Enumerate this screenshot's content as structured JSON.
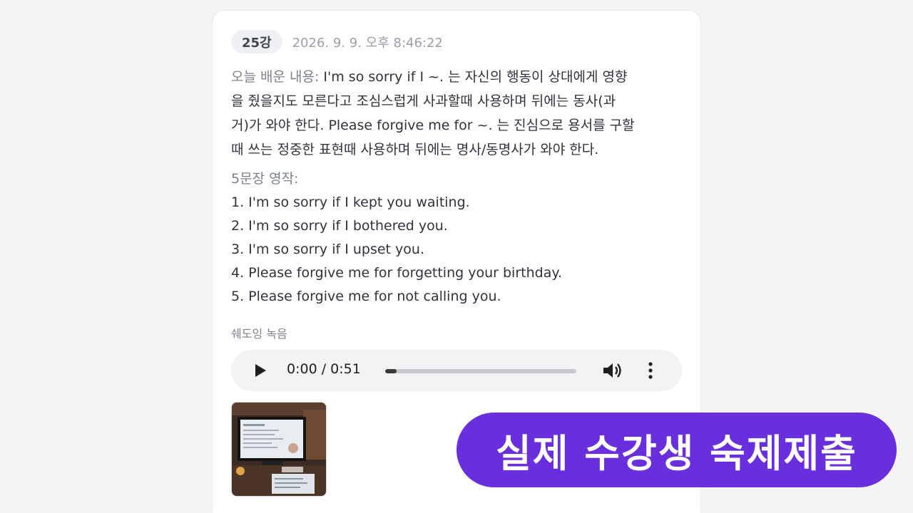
{
  "lesson": {
    "badge": "25강",
    "timestamp": "2026. 9. 9. 오후 8:46:22"
  },
  "summary": {
    "label": "오늘 배운 내용:",
    "line1": " I'm so sorry if I ~. 는 자신의 행동이 상대에게 영향",
    "line2": "을 줬을지도 모른다고 조심스럽게 사과할때 사용하며 뒤에는 동사(과",
    "line3": "거)가 와야 한다. Please forgive me for ~. 는 진심으로 용서를 구할",
    "line4": "때 쓰는 정중한 표현때 사용하며 뒤에는 명사/동명사가 와야 한다."
  },
  "composition": {
    "title": "5문장 영작:",
    "sentences": [
      "1. I'm so sorry if I kept you waiting.",
      "2. I'm so sorry if I bothered you.",
      "3. I'm so sorry if I upset you.",
      "4. Please forgive me for forgetting your birthday.",
      "5. Please forgive me for not calling you."
    ]
  },
  "recording": {
    "label": "쉐도잉 녹음",
    "time": "0:00 / 0:51",
    "progress_fraction": 0.06,
    "play_icon": "play-icon",
    "volume_icon": "volume-icon",
    "more_icon": "more-vertical-icon"
  },
  "banner": {
    "text": "실제 수강생 숙제제출",
    "color": "#6a2fdd"
  }
}
